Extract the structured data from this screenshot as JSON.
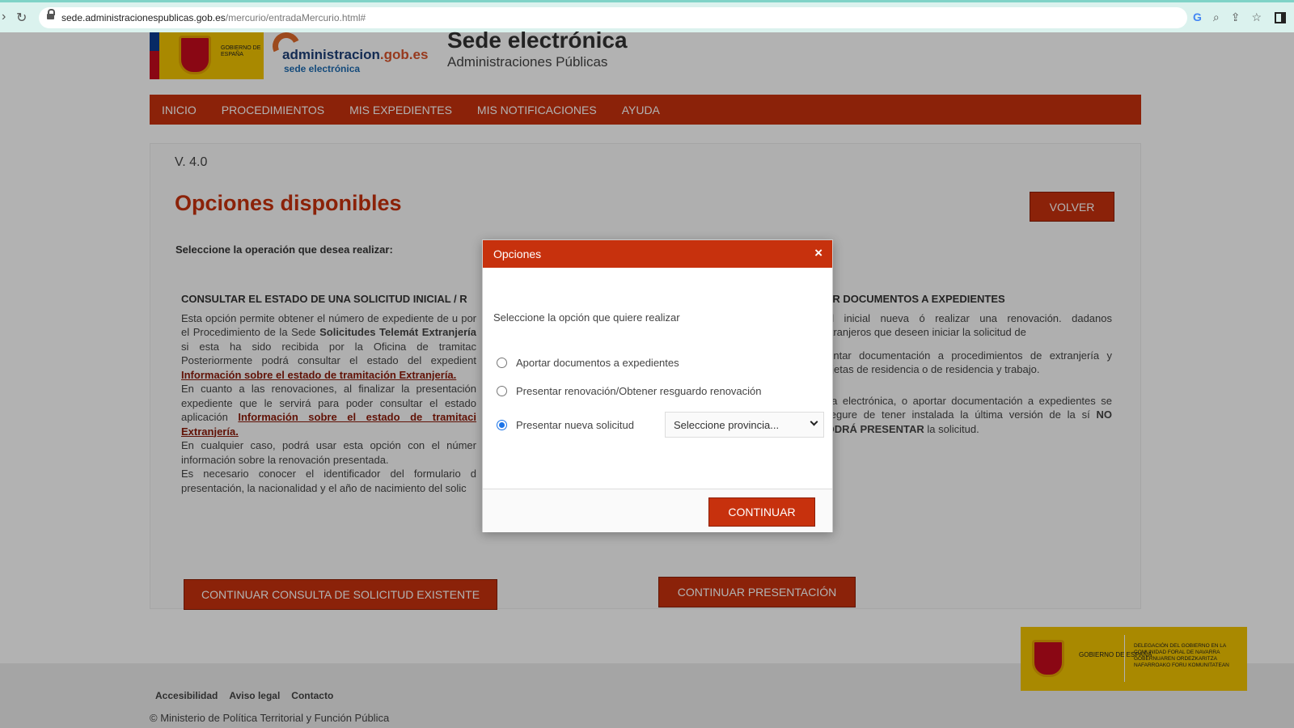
{
  "browser": {
    "url_domain": "sede.administracionespublicas.gob.es",
    "url_path": "/mercurio/entradaMercurio.html#"
  },
  "header": {
    "gob_logo_text": "GOBIERNO DE ESPAÑA",
    "admin_logo_main": "administracion",
    "admin_logo_gob": ".gob.es",
    "admin_logo_sub": "sede electrónica",
    "title": "Sede electrónica",
    "subtitle": "Administraciones Públicas"
  },
  "nav": {
    "items": [
      "INICIO",
      "PROCEDIMIENTOS",
      "MIS EXPEDIENTES",
      "MIS NOTIFICACIONES",
      "AYUDA"
    ]
  },
  "main": {
    "version": "V. 4.0",
    "title": "Opciones disponibles",
    "volver_label": "VOLVER",
    "select_operation": "Seleccione la operación que desea realizar:",
    "left": {
      "heading": "CONSULTAR EL ESTADO DE UNA SOLICITUD INICIAL / R",
      "p1a": "Esta opción permite obtener el número de expediente de u por el Procedimiento de la Sede ",
      "p1b": "Solicitudes Telemát",
      "p1c": "Extranjería",
      "p1d": " si esta ha sido recibida por la Oficina de tramitac Posteriormente podrá consultar el estado del expedient ",
      "link1": "Información sobre el estado de tramitación Extranjería.",
      "p2a": "En cuanto a las renovaciones, al finalizar la presentación expediente que le servirá para poder consultar el estado aplicación ",
      "link2": "Información sobre el estado de tramitaci Extranjería.",
      "p3": "En cualquier caso, podrá usar esta opción con el númer información sobre la renovación presentada.",
      "p4": "Es necesario conocer el identificador del formulario d presentación, la nacionalidad y el año de nacimiento del solic",
      "button": "CONTINUAR CONSULTA DE SOLICITUD EXISTENTE"
    },
    "right": {
      "heading": "TAR DOCUMENTOS A EXPEDIENTES",
      "p1": "tud inicial nueva ó realizar una renovación. dadanos extranjeros que deseen iniciar la solicitud de",
      "p2": "djuntar documentación a procedimientos de extranjería y tarjetas de residencia o de residencia y trabajo.",
      "p3a": "rma electrónica, o aportar documentación a expedientes se asegure de tener instalada la última versión de la sí ",
      "p3b": "NO PODRÁ PRESENTAR",
      "p3c": " la solicitud.",
      "button": "CONTINUAR PRESENTACIÓN"
    }
  },
  "footer": {
    "links": [
      "Accesibilidad",
      "Aviso legal",
      "Contacto"
    ],
    "copyright": "© Ministerio de Política Territorial y Función Pública",
    "deleg_gob": "GOBIERNO DE ESPAÑA",
    "deleg_text": "DELEGACIÓN DEL GOBIERNO EN LA COMUNIDAD FORAL DE NAVARRA GOBERNUAREN ORDEZKARITZA NAFARROAKO FORU KOMUNITATEAN"
  },
  "modal": {
    "title": "Opciones",
    "close_icon": "×",
    "prompt": "Seleccione la opción que quiere realizar",
    "options": [
      {
        "label": "Aportar documentos a expedientes",
        "checked": false
      },
      {
        "label": "Presentar renovación/Obtener resguardo renovación",
        "checked": false
      },
      {
        "label": "Presentar nueva solicitud",
        "checked": true
      }
    ],
    "province_placeholder": "Seleccione provincia...",
    "continue_label": "CONTINUAR"
  },
  "colors": {
    "brand_red": "#c7310d",
    "radio_blue": "#1a73e8",
    "gov_yellow": "#f2c500"
  }
}
